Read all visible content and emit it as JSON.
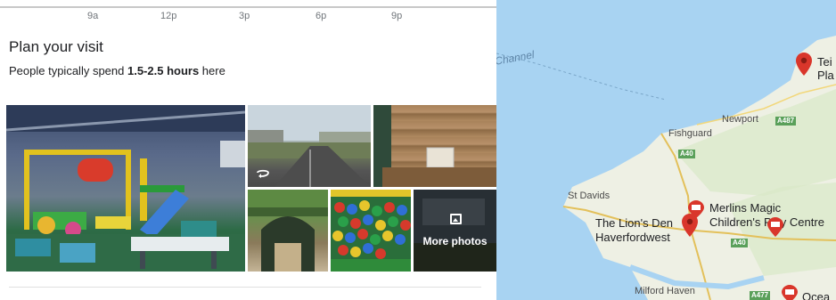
{
  "popular_times": {
    "hours": [
      "9a",
      "12p",
      "3p",
      "6p",
      "9p"
    ]
  },
  "visit": {
    "title": "Plan your visit",
    "subtitle_prefix": "People typically spend ",
    "subtitle_duration": "1.5-2.5 hours",
    "subtitle_suffix": " here"
  },
  "photos": {
    "more_label": "More photos"
  },
  "map": {
    "sea_label": "Channel",
    "towns": [
      "Newport",
      "Fishguard",
      "St Davids",
      "Milford Haven"
    ],
    "roads": [
      "A487",
      "A40",
      "A40",
      "A477"
    ],
    "places": {
      "merlins_line1": "Merlins Magic",
      "merlins_line2": "Children's Play Centre",
      "lions_line1": "The Lion's Den",
      "lions_line2": "Haverfordwest",
      "teifi_partial_1": "Tei",
      "teifi_partial_2": "Pla",
      "bottom_partial": "Ocea"
    },
    "colors": {
      "water": "#a8d3f2",
      "land": "#eef0e4",
      "pin": "#d9362b"
    }
  }
}
